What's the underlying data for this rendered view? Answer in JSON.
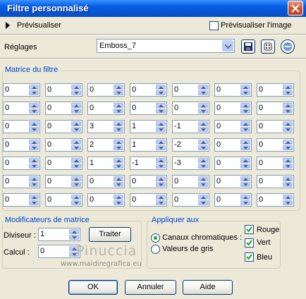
{
  "window": {
    "title": "Filtre personnalisé"
  },
  "colors": {
    "titlebar": "#0a5fe6",
    "group_title": "#0046d5",
    "check": "#21a121"
  },
  "preview": {
    "label": "Prévisualiser",
    "preview_image_label": "Prévisualiser l'image",
    "preview_image_checked": false
  },
  "presets": {
    "label": "Réglages",
    "value": "Emboss_7",
    "icons": [
      "save-icon",
      "randomize-icon",
      "reset-icon"
    ]
  },
  "matrix": {
    "title": "Matrice du filtre",
    "rows": [
      [
        "0",
        "0",
        "0",
        "0",
        "0",
        "0",
        "0"
      ],
      [
        "0",
        "0",
        "0",
        "0",
        "0",
        "0",
        "0"
      ],
      [
        "0",
        "0",
        "3",
        "1",
        "-1",
        "0",
        "0"
      ],
      [
        "0",
        "0",
        "2",
        "1",
        "-2",
        "0",
        "0"
      ],
      [
        "0",
        "0",
        "1",
        "-1",
        "-3",
        "0",
        "0"
      ],
      [
        "0",
        "0",
        "0",
        "0",
        "0",
        "0",
        "0"
      ],
      [
        "0",
        "0",
        "0",
        "0",
        "0",
        "0",
        "0"
      ]
    ]
  },
  "modifiers": {
    "title": "Modificateurs de matrice",
    "divisor_label": "Diviseur :",
    "divisor": "1",
    "bias_label": "Calcul :",
    "bias": "0",
    "fit_label": "Traiter"
  },
  "apply": {
    "title": "Appliquer aux",
    "color_channels": "Canaux chromatiques :",
    "greyscale": "Valeurs de gris",
    "red": "Rouge",
    "green": "Vert",
    "blue": "Bleu"
  },
  "watermark": {
    "main": "Pinuccia",
    "sub": "www.maidiregrafica.eu"
  },
  "buttons": {
    "ok": "OK",
    "cancel": "Annuler",
    "help": "Aide"
  }
}
